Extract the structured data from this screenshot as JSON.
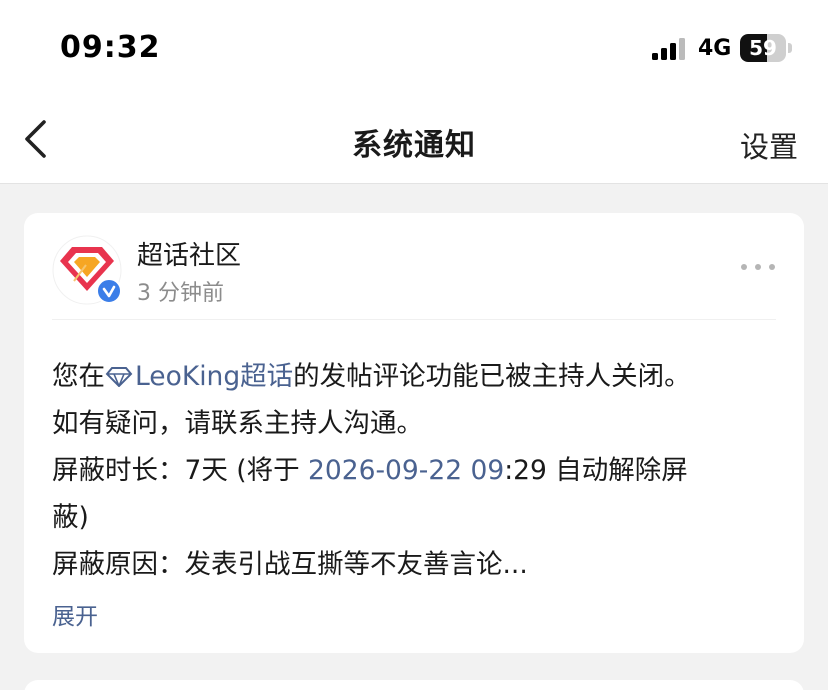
{
  "status_bar": {
    "time": "09:32",
    "network": "4G",
    "battery_level": 59,
    "battery_text": "59",
    "icons": [
      "signal-icon",
      "battery-icon"
    ]
  },
  "nav": {
    "title": "系统通知",
    "settings_label": "设置",
    "back_icon": "chevron-left-icon"
  },
  "notification": {
    "sender": "超话社区",
    "time_ago": "3 分钟前",
    "avatar_icon": "diamond-logo-icon",
    "badge_icon": "verified-v-icon",
    "more_icon": "more-dots-icon",
    "line1_prefix": "您在",
    "topic_name": "LeoKing超话",
    "topic_icon": "diamond-topic-icon",
    "line1_suffix": "的发帖评论功能已被主持人关闭。",
    "line2": "如有疑问，请联系主持人沟通。",
    "duration_prefix": "屏蔽时长：7天 (将于 ",
    "duration_date": "2026-09-22 09",
    "duration_suffix": ":29 自动解除屏",
    "duration_wrap": "蔽)",
    "reason": "屏蔽原因：发表引战互撕等不友善言论...",
    "expand_label": "展开"
  },
  "colors": {
    "link": "#4a6290",
    "background": "#f2f2f2",
    "card": "#ffffff",
    "verified": "#3b7ee8",
    "logo_red": "#e8344e"
  }
}
